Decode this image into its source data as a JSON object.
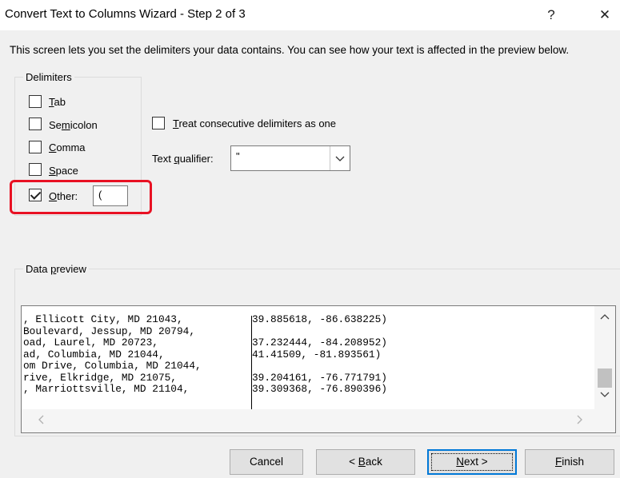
{
  "window": {
    "title": "Convert Text to Columns Wizard - Step 2 of 3",
    "help_glyph": "?",
    "close_glyph": "✕"
  },
  "description": "This screen lets you set the delimiters your data contains.  You can see how your text is affected in the preview below.",
  "delimiters": {
    "group_label": "Delimiters",
    "items": [
      {
        "pre": "",
        "key": "T",
        "post": "ab",
        "checked": false
      },
      {
        "pre": "Se",
        "key": "m",
        "post": "icolon",
        "checked": false
      },
      {
        "pre": "",
        "key": "C",
        "post": "omma",
        "checked": false
      },
      {
        "pre": "",
        "key": "S",
        "post": "pace",
        "checked": false
      },
      {
        "pre": "",
        "key": "O",
        "post": "ther:",
        "checked": true
      }
    ],
    "other_value": "("
  },
  "consecutive": {
    "pre": "",
    "key": "T",
    "post": "reat consecutive delimiters as one",
    "checked": false
  },
  "text_qualifier": {
    "pre": "Text ",
    "key": "q",
    "post": "ualifier:",
    "selected": "\""
  },
  "preview": {
    "label_pre": "Data ",
    "label_key": "p",
    "label_post": "review",
    "rows": [
      {
        "c1": ", Ellicott City, MD 21043,",
        "c2": "39.885618, -86.638225)"
      },
      {
        "c1": "Boulevard, Jessup, MD 20794,",
        "c2": ""
      },
      {
        "c1": "oad, Laurel, MD 20723,",
        "c2": "37.232444, -84.208952)"
      },
      {
        "c1": "ad, Columbia, MD 21044,",
        "c2": "41.41509, -81.893561)"
      },
      {
        "c1": "om Drive, Columbia, MD 21044,",
        "c2": ""
      },
      {
        "c1": "rive, Elkridge, MD 21075,",
        "c2": "39.204161, -76.771791)"
      },
      {
        "c1": ", Marriottsville, MD 21104,",
        "c2": "39.309368, -76.890396)"
      },
      {
        "c1": "",
        "c2": ""
      }
    ]
  },
  "buttons": {
    "cancel": "Cancel",
    "back_pre": "< ",
    "back_key": "B",
    "back_post": "ack",
    "next_key": "N",
    "next_post": "ext >",
    "finish_key": "F",
    "finish_post": "inish"
  }
}
